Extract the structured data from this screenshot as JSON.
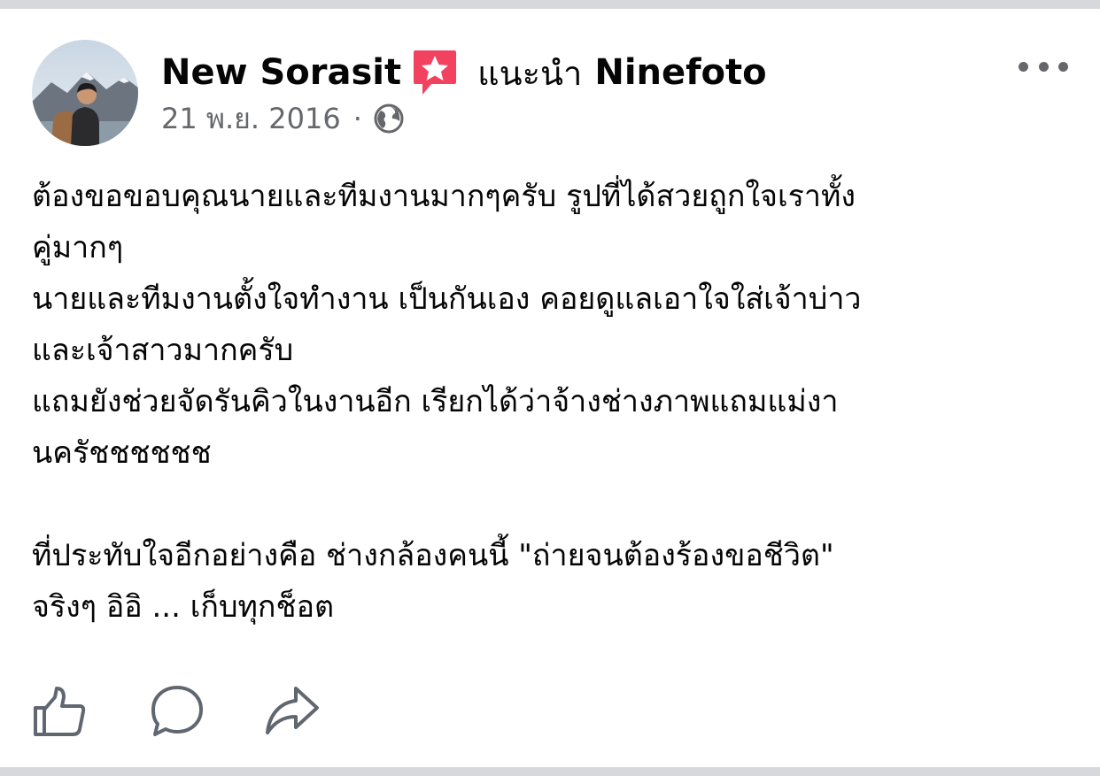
{
  "post": {
    "author": "New Sorasit",
    "recommend_text": "แนะนำ",
    "page_name": "Ninefoto",
    "date": "21 พ.ย. 2016",
    "separator": "·",
    "privacy_icon": "globe-icon",
    "body": [
      "ต้องขอขอบคุณนายและทีมงานมากๆครับ รูปที่ได้สวยถูกใจเราทั้ง",
      "คู่มากๆ",
      "นายและทีมงานตั้งใจทำงาน เป็นกันเอง คอยดูแลเอาใจใส่เจ้าบ่าว",
      "และเจ้าสาวมากครับ",
      "แถมยังช่วยจัดรันคิวในงานอีก เรียกได้ว่าจ้างช่างภาพแถมแม่งา",
      "นครัชชชชชช",
      "",
      "ที่ประทับใจอีกอย่างคือ ช่างกล้องคนนี้ \"ถ่ายจนต้องร้องขอชีวิต\"",
      "จริงๆ อิอิ ... เก็บทุกช็อต"
    ]
  },
  "icons": {
    "badge": "recommend-star-icon",
    "more": "more-options-icon",
    "like": "like-icon",
    "comment": "comment-icon",
    "share": "share-icon"
  },
  "colors": {
    "badge_pink": "#f3425f",
    "meta_gray": "#65676b",
    "icon_gray": "#606770",
    "text": "#050505",
    "edge": "#d7d8dc"
  }
}
